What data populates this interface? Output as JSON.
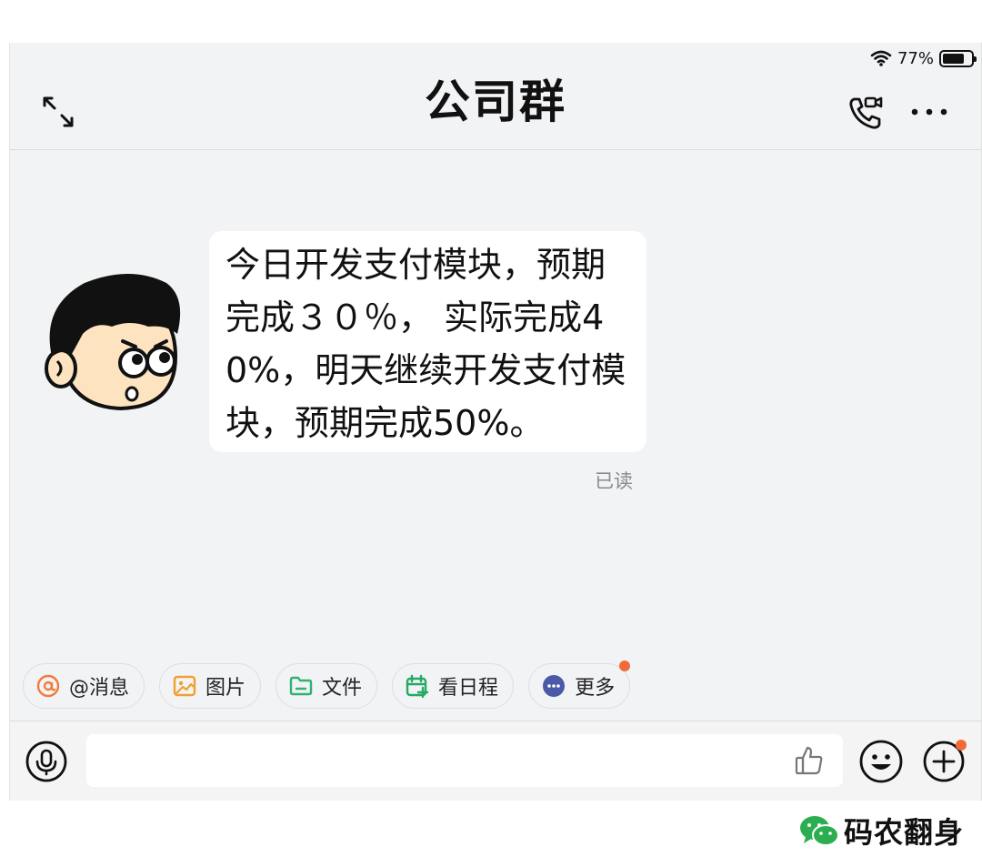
{
  "status_bar": {
    "battery_text": "77%",
    "battery_level": 0.77
  },
  "header": {
    "title": "公司群",
    "icons": [
      "expand-icon",
      "video-call-icon",
      "more-icon"
    ]
  },
  "message": {
    "text": "今日开发支付模块，预期完成３０％， 实际完成40%，明天继续开发支付模块，预期完成50%。",
    "read_status": "已读"
  },
  "quick_actions": [
    {
      "label": "@消息",
      "icon": "at-icon",
      "color": "#f07b3f"
    },
    {
      "label": "图片",
      "icon": "image-icon",
      "color": "#f0a030"
    },
    {
      "label": "文件",
      "icon": "folder-icon",
      "color": "#2fb36e"
    },
    {
      "label": "看日程",
      "icon": "calendar-icon",
      "color": "#22aa66"
    },
    {
      "label": "更多",
      "icon": "more-dots-icon",
      "color": "#4a5aa8",
      "has_badge": true
    }
  ],
  "input": {
    "value": "",
    "placeholder": ""
  },
  "watermark": {
    "text": "码农翻身"
  },
  "colors": {
    "background": "#f2f3f5",
    "bubble": "#ffffff",
    "badge": "#f26a3a"
  }
}
